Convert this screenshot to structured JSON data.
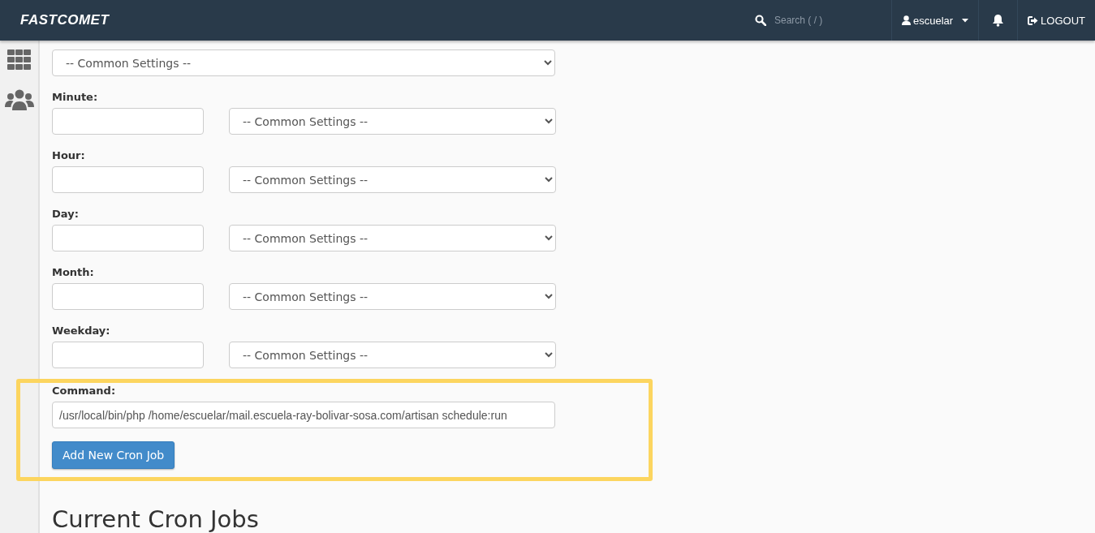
{
  "header": {
    "logo": "FASTCOMET",
    "search": {
      "placeholder": "Search ( / )"
    },
    "user": "escuelar",
    "logout": "LOGOUT"
  },
  "sidebar": {
    "items": [
      {
        "kind": "grid"
      },
      {
        "kind": "users"
      }
    ]
  },
  "common_settings": {
    "select": "-- Common Settings --"
  },
  "fields": [
    {
      "label": "Minute:",
      "select": "-- Common Settings --"
    },
    {
      "label": "Hour:",
      "select": "-- Common Settings --"
    },
    {
      "label": "Day:",
      "select": "-- Common Settings --"
    },
    {
      "label": "Month:",
      "select": "-- Common Settings --"
    },
    {
      "label": "Weekday:",
      "select": "-- Common Settings --"
    }
  ],
  "command": {
    "label": "Command:",
    "value": "/usr/local/bin/php /home/escuelar/mail.escuela-ray-bolivar-sosa.com/artisan schedule:run",
    "highlighted": true
  },
  "add_button": "Add New Cron Job",
  "heading": "Current Cron Jobs"
}
